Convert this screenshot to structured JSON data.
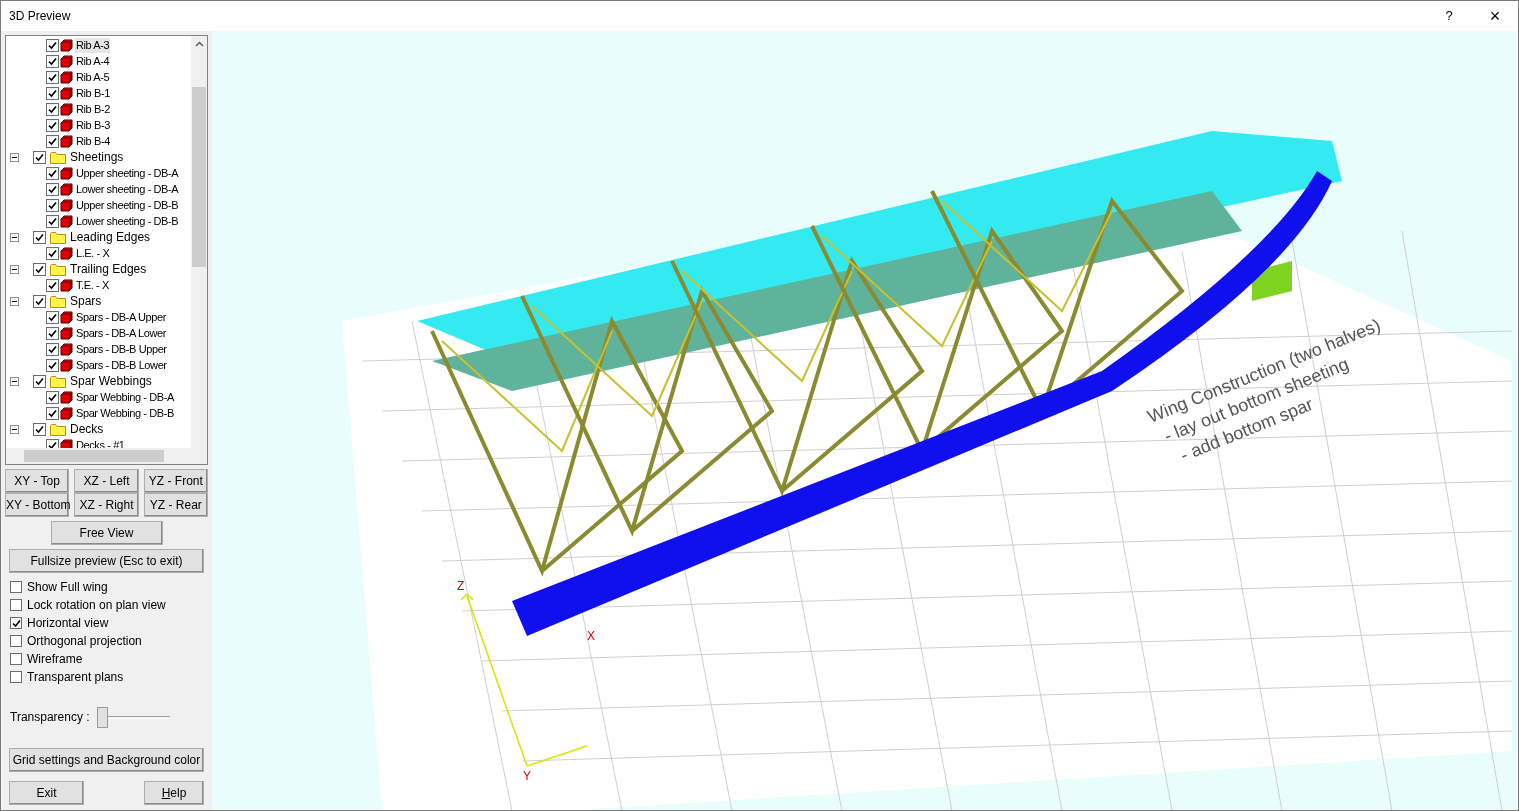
{
  "window": {
    "title": "3D Preview",
    "help_glyph": "?",
    "close_glyph": "×"
  },
  "tree": {
    "orphan_items": [
      {
        "label": "Rib A-3",
        "checked": true,
        "selected": true
      },
      {
        "label": "Rib A-4",
        "checked": true,
        "selected": false
      },
      {
        "label": "Rib A-5",
        "checked": true,
        "selected": false
      },
      {
        "label": "Rib B-1",
        "checked": true,
        "selected": false
      },
      {
        "label": "Rib B-2",
        "checked": true,
        "selected": false
      },
      {
        "label": "Rib B-3",
        "checked": true,
        "selected": false
      },
      {
        "label": "Rib B-4",
        "checked": true,
        "selected": false
      }
    ],
    "folders": [
      {
        "label": "Sheetings",
        "checked": true,
        "expanded": true,
        "children": [
          {
            "label": "Upper sheeting - DB-A",
            "checked": true,
            "selected": false
          },
          {
            "label": "Lower sheeting - DB-A",
            "checked": true,
            "selected": false
          },
          {
            "label": "Upper sheeting - DB-B",
            "checked": true,
            "selected": false
          },
          {
            "label": "Lower sheeting - DB-B",
            "checked": true,
            "selected": false
          }
        ]
      },
      {
        "label": "Leading Edges",
        "checked": true,
        "expanded": true,
        "children": [
          {
            "label": "L.E. - X",
            "checked": true,
            "selected": false
          }
        ]
      },
      {
        "label": "Trailing Edges",
        "checked": true,
        "expanded": true,
        "children": [
          {
            "label": "T.E. - X",
            "checked": true,
            "selected": false
          }
        ]
      },
      {
        "label": "Spars",
        "checked": true,
        "expanded": true,
        "children": [
          {
            "label": "Spars - DB-A Upper",
            "checked": true,
            "selected": false
          },
          {
            "label": "Spars - DB-A Lower",
            "checked": true,
            "selected": false
          },
          {
            "label": "Spars - DB-B Upper",
            "checked": true,
            "selected": false
          },
          {
            "label": "Spars - DB-B Lower",
            "checked": true,
            "selected": false
          }
        ]
      },
      {
        "label": "Spar Webbings",
        "checked": true,
        "expanded": true,
        "children": [
          {
            "label": "Spar Webbing - DB-A",
            "checked": true,
            "selected": false
          },
          {
            "label": "Spar Webbing - DB-B",
            "checked": true,
            "selected": false
          }
        ]
      },
      {
        "label": "Decks",
        "checked": true,
        "expanded": true,
        "children": [
          {
            "label": "Decks - #1",
            "checked": true,
            "selected": false
          }
        ]
      }
    ]
  },
  "view_buttons": [
    "XY - Top",
    "XZ - Left",
    "YZ - Front",
    "XY - Bottom",
    "XZ - Right",
    "YZ - Rear"
  ],
  "free_view_button": "Free View",
  "fullsize_button": "Fullsize preview (Esc to exit)",
  "options": [
    {
      "label": "Show Full wing",
      "checked": false
    },
    {
      "label": "Lock rotation on plan view",
      "checked": false
    },
    {
      "label": "Horizontal view",
      "checked": true
    },
    {
      "label": "Orthogonal projection",
      "checked": false
    },
    {
      "label": "Wireframe",
      "checked": false
    },
    {
      "label": "Transparent plans",
      "checked": false
    }
  ],
  "transparency": {
    "label": "Transparency :",
    "level": 0.05
  },
  "grid_button": "Grid settings and Background color",
  "exit_button": "Exit",
  "help_button": {
    "label": "Help",
    "underline_first": true
  },
  "viewport": {
    "axes": [
      "Z",
      "Y",
      "X"
    ],
    "plan_note": [
      "Wing Construction (two halves)",
      "- lay out bottom sheeting",
      "- add bottom spar"
    ]
  }
}
